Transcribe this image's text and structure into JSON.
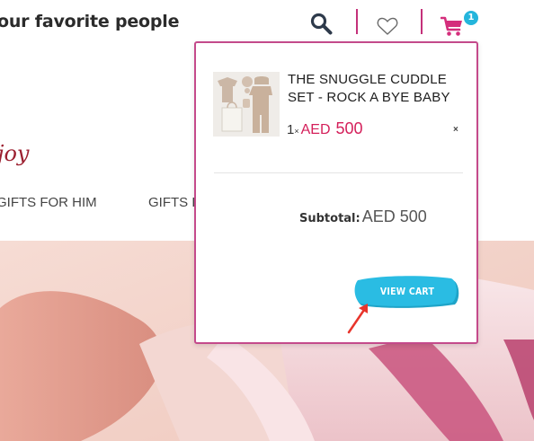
{
  "header": {
    "tagline": "our favorite people",
    "icons": {
      "search": "search-icon",
      "wishlist": "heart-icon",
      "cart": "cart-icon"
    },
    "cart_count": "1",
    "accent_color": "#c4317a"
  },
  "hero": {
    "script_text": "joy"
  },
  "nav": {
    "items": [
      "GIFTS FOR HIM",
      "GIFTS F"
    ]
  },
  "cart_popup": {
    "border_color": "#c44a8b",
    "item": {
      "name": "THE SNUGGLE CUDDLE SET - ROCK A BYE BABY",
      "qty": "1",
      "times": "×",
      "currency": "AED",
      "price": "500",
      "remove": "×",
      "price_color": "#d41f5a"
    },
    "subtotal_label": "Subtotal:",
    "subtotal_value": "AED 500",
    "view_cart_label": "VIEW CART",
    "button_color": "#24b5dc"
  }
}
